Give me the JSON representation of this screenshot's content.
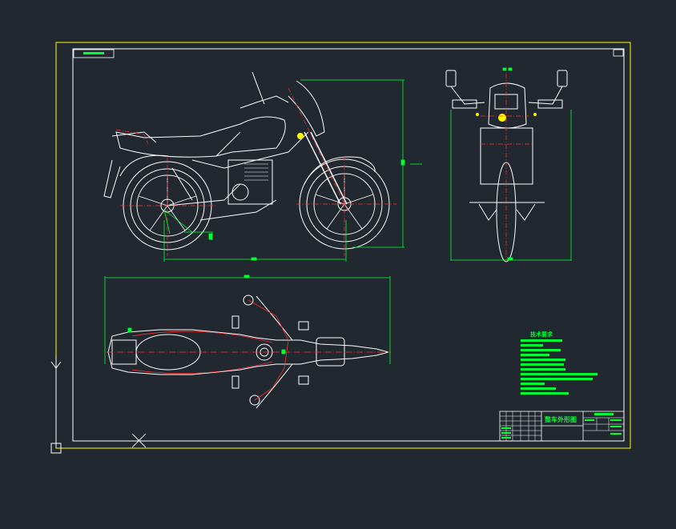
{
  "drawing": {
    "title_block_name": "整车外形图",
    "tech_requirements_title": "技术要求",
    "colors": {
      "background": "#212830",
      "frame": "#ffff00",
      "geometry": "#ffffff",
      "centerline": "#ff3030",
      "dimension": "#00ff33",
      "marker": "#ffff00"
    }
  },
  "views": [
    {
      "id": "side",
      "name": "side-view"
    },
    {
      "id": "front",
      "name": "front-view"
    },
    {
      "id": "top",
      "name": "top-view"
    }
  ],
  "ucs_icon": "ucs-y-axis-icon",
  "crosshair_icon": "crosshair-cursor-icon"
}
